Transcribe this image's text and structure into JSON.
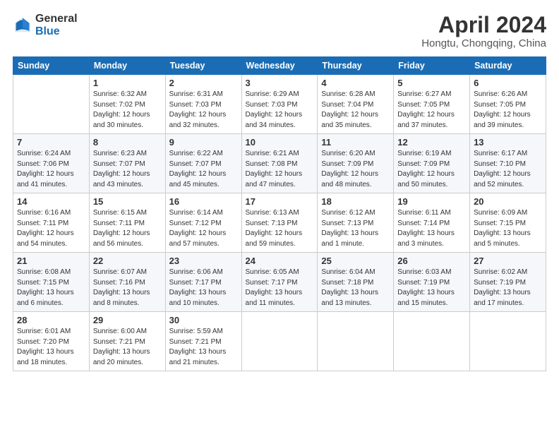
{
  "header": {
    "logo_general": "General",
    "logo_blue": "Blue",
    "month_year": "April 2024",
    "location": "Hongtu, Chongqing, China"
  },
  "weekdays": [
    "Sunday",
    "Monday",
    "Tuesday",
    "Wednesday",
    "Thursday",
    "Friday",
    "Saturday"
  ],
  "weeks": [
    [
      {
        "day": "",
        "sunrise": "",
        "sunset": "",
        "daylight": ""
      },
      {
        "day": "1",
        "sunrise": "Sunrise: 6:32 AM",
        "sunset": "Sunset: 7:02 PM",
        "daylight": "Daylight: 12 hours and 30 minutes."
      },
      {
        "day": "2",
        "sunrise": "Sunrise: 6:31 AM",
        "sunset": "Sunset: 7:03 PM",
        "daylight": "Daylight: 12 hours and 32 minutes."
      },
      {
        "day": "3",
        "sunrise": "Sunrise: 6:29 AM",
        "sunset": "Sunset: 7:03 PM",
        "daylight": "Daylight: 12 hours and 34 minutes."
      },
      {
        "day": "4",
        "sunrise": "Sunrise: 6:28 AM",
        "sunset": "Sunset: 7:04 PM",
        "daylight": "Daylight: 12 hours and 35 minutes."
      },
      {
        "day": "5",
        "sunrise": "Sunrise: 6:27 AM",
        "sunset": "Sunset: 7:05 PM",
        "daylight": "Daylight: 12 hours and 37 minutes."
      },
      {
        "day": "6",
        "sunrise": "Sunrise: 6:26 AM",
        "sunset": "Sunset: 7:05 PM",
        "daylight": "Daylight: 12 hours and 39 minutes."
      }
    ],
    [
      {
        "day": "7",
        "sunrise": "Sunrise: 6:24 AM",
        "sunset": "Sunset: 7:06 PM",
        "daylight": "Daylight: 12 hours and 41 minutes."
      },
      {
        "day": "8",
        "sunrise": "Sunrise: 6:23 AM",
        "sunset": "Sunset: 7:07 PM",
        "daylight": "Daylight: 12 hours and 43 minutes."
      },
      {
        "day": "9",
        "sunrise": "Sunrise: 6:22 AM",
        "sunset": "Sunset: 7:07 PM",
        "daylight": "Daylight: 12 hours and 45 minutes."
      },
      {
        "day": "10",
        "sunrise": "Sunrise: 6:21 AM",
        "sunset": "Sunset: 7:08 PM",
        "daylight": "Daylight: 12 hours and 47 minutes."
      },
      {
        "day": "11",
        "sunrise": "Sunrise: 6:20 AM",
        "sunset": "Sunset: 7:09 PM",
        "daylight": "Daylight: 12 hours and 48 minutes."
      },
      {
        "day": "12",
        "sunrise": "Sunrise: 6:19 AM",
        "sunset": "Sunset: 7:09 PM",
        "daylight": "Daylight: 12 hours and 50 minutes."
      },
      {
        "day": "13",
        "sunrise": "Sunrise: 6:17 AM",
        "sunset": "Sunset: 7:10 PM",
        "daylight": "Daylight: 12 hours and 52 minutes."
      }
    ],
    [
      {
        "day": "14",
        "sunrise": "Sunrise: 6:16 AM",
        "sunset": "Sunset: 7:11 PM",
        "daylight": "Daylight: 12 hours and 54 minutes."
      },
      {
        "day": "15",
        "sunrise": "Sunrise: 6:15 AM",
        "sunset": "Sunset: 7:11 PM",
        "daylight": "Daylight: 12 hours and 56 minutes."
      },
      {
        "day": "16",
        "sunrise": "Sunrise: 6:14 AM",
        "sunset": "Sunset: 7:12 PM",
        "daylight": "Daylight: 12 hours and 57 minutes."
      },
      {
        "day": "17",
        "sunrise": "Sunrise: 6:13 AM",
        "sunset": "Sunset: 7:13 PM",
        "daylight": "Daylight: 12 hours and 59 minutes."
      },
      {
        "day": "18",
        "sunrise": "Sunrise: 6:12 AM",
        "sunset": "Sunset: 7:13 PM",
        "daylight": "Daylight: 13 hours and 1 minute."
      },
      {
        "day": "19",
        "sunrise": "Sunrise: 6:11 AM",
        "sunset": "Sunset: 7:14 PM",
        "daylight": "Daylight: 13 hours and 3 minutes."
      },
      {
        "day": "20",
        "sunrise": "Sunrise: 6:09 AM",
        "sunset": "Sunset: 7:15 PM",
        "daylight": "Daylight: 13 hours and 5 minutes."
      }
    ],
    [
      {
        "day": "21",
        "sunrise": "Sunrise: 6:08 AM",
        "sunset": "Sunset: 7:15 PM",
        "daylight": "Daylight: 13 hours and 6 minutes."
      },
      {
        "day": "22",
        "sunrise": "Sunrise: 6:07 AM",
        "sunset": "Sunset: 7:16 PM",
        "daylight": "Daylight: 13 hours and 8 minutes."
      },
      {
        "day": "23",
        "sunrise": "Sunrise: 6:06 AM",
        "sunset": "Sunset: 7:17 PM",
        "daylight": "Daylight: 13 hours and 10 minutes."
      },
      {
        "day": "24",
        "sunrise": "Sunrise: 6:05 AM",
        "sunset": "Sunset: 7:17 PM",
        "daylight": "Daylight: 13 hours and 11 minutes."
      },
      {
        "day": "25",
        "sunrise": "Sunrise: 6:04 AM",
        "sunset": "Sunset: 7:18 PM",
        "daylight": "Daylight: 13 hours and 13 minutes."
      },
      {
        "day": "26",
        "sunrise": "Sunrise: 6:03 AM",
        "sunset": "Sunset: 7:19 PM",
        "daylight": "Daylight: 13 hours and 15 minutes."
      },
      {
        "day": "27",
        "sunrise": "Sunrise: 6:02 AM",
        "sunset": "Sunset: 7:19 PM",
        "daylight": "Daylight: 13 hours and 17 minutes."
      }
    ],
    [
      {
        "day": "28",
        "sunrise": "Sunrise: 6:01 AM",
        "sunset": "Sunset: 7:20 PM",
        "daylight": "Daylight: 13 hours and 18 minutes."
      },
      {
        "day": "29",
        "sunrise": "Sunrise: 6:00 AM",
        "sunset": "Sunset: 7:21 PM",
        "daylight": "Daylight: 13 hours and 20 minutes."
      },
      {
        "day": "30",
        "sunrise": "Sunrise: 5:59 AM",
        "sunset": "Sunset: 7:21 PM",
        "daylight": "Daylight: 13 hours and 21 minutes."
      },
      {
        "day": "",
        "sunrise": "",
        "sunset": "",
        "daylight": ""
      },
      {
        "day": "",
        "sunrise": "",
        "sunset": "",
        "daylight": ""
      },
      {
        "day": "",
        "sunrise": "",
        "sunset": "",
        "daylight": ""
      },
      {
        "day": "",
        "sunrise": "",
        "sunset": "",
        "daylight": ""
      }
    ]
  ]
}
